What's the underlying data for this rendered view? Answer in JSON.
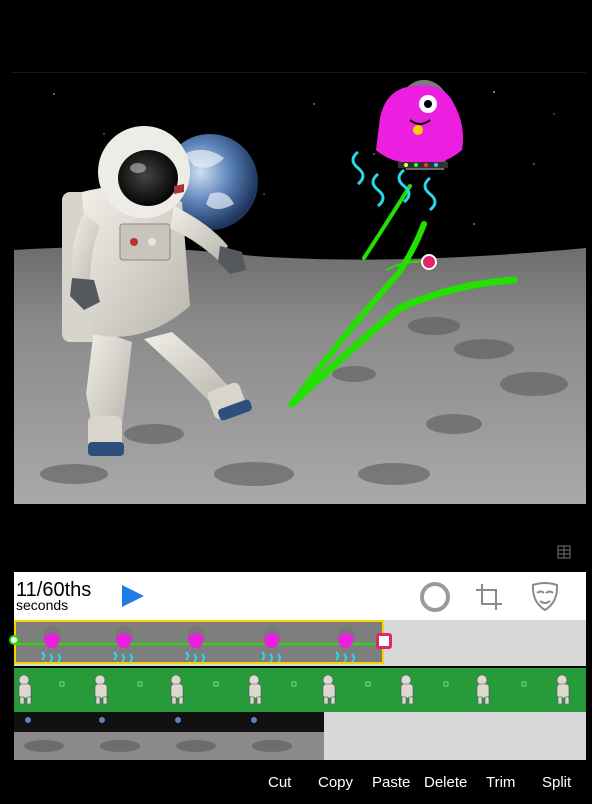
{
  "toolbar": {
    "time_value": "11/60ths",
    "time_unit": "seconds",
    "play_icon": "play-icon",
    "tools": [
      "record-circle-icon",
      "crop-icon",
      "mask-icon"
    ]
  },
  "timeline": {
    "tracks": [
      {
        "name": "monster-character-track",
        "thumb_icon": "monster-thumbnail",
        "selected": true
      },
      {
        "name": "astronaut-character-track",
        "thumb_icon": "astronaut-thumbnail",
        "selected": false
      },
      {
        "name": "background-track",
        "thumb_icon": "moon-background-thumbnail",
        "selected": false
      }
    ]
  },
  "edit_actions": {
    "cut": "Cut",
    "copy": "Copy",
    "paste": "Paste",
    "delete": "Delete",
    "trim": "Trim",
    "split": "Split"
  },
  "colors": {
    "accent_blue": "#1f7be6",
    "selection_yellow": "#f5d400",
    "motion_path_green": "#22e000",
    "handle_magenta": "#e0246e",
    "track_green": "#279b3a"
  }
}
